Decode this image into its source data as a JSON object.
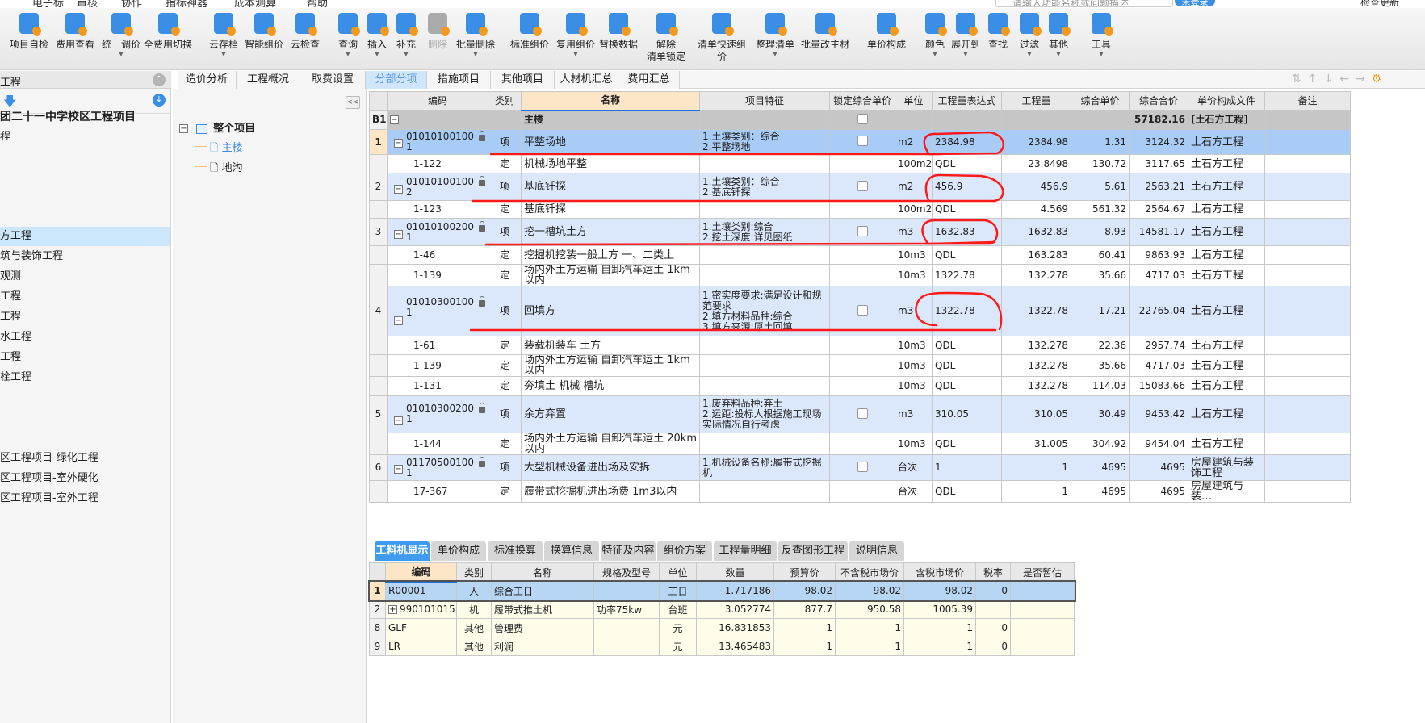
{
  "menu": [
    "电子标",
    "审核",
    "协作",
    "指标神器",
    "成本测算",
    "帮助"
  ],
  "search_placeholder": "请输入功能名称或问题描述",
  "login_label": "未登录",
  "update_label": "检查更新",
  "toolbar": [
    {
      "label": "项目自检",
      "icon": "check-report-icon",
      "color": "#3a8ee6",
      "dropdown": false
    },
    {
      "label": "费用查看",
      "icon": "cost-view-icon",
      "color": "#3a8ee6",
      "dropdown": false
    },
    {
      "label": "统一调价",
      "icon": "adjust-price-icon",
      "color": "#3a8ee6",
      "dropdown": true
    },
    {
      "label": "全费用切换",
      "icon": "switch-icon",
      "color": "#3a8ee6",
      "dropdown": false
    },
    {
      "label": "云存档",
      "icon": "cloud-upload-icon",
      "color": "#3a8ee6",
      "dropdown": true
    },
    {
      "label": "智能组价",
      "icon": "smart-price-icon",
      "color": "#3a8ee6",
      "dropdown": false
    },
    {
      "label": "云检查",
      "icon": "cloud-check-icon",
      "color": "#3a8ee6",
      "dropdown": false
    },
    {
      "label": "查询",
      "icon": "query-icon",
      "color": "#3a8ee6",
      "dropdown": true
    },
    {
      "label": "插入",
      "icon": "insert-icon",
      "color": "#3a8ee6",
      "dropdown": true
    },
    {
      "label": "补充",
      "icon": "supplement-icon",
      "color": "#3a8ee6",
      "dropdown": true
    },
    {
      "label": "删除",
      "icon": "trash-icon",
      "color": "#aaaaaa",
      "dropdown": false,
      "disabled": true
    },
    {
      "label": "批量删除",
      "icon": "batch-delete-icon",
      "color": "#3a8ee6",
      "dropdown": true
    },
    {
      "label": "标准组价",
      "icon": "standard-price-icon",
      "color": "#3a8ee6",
      "dropdown": false
    },
    {
      "label": "复用组价",
      "icon": "reuse-price-icon",
      "color": "#3a8ee6",
      "dropdown": true
    },
    {
      "label": "替换数据",
      "icon": "replace-data-icon",
      "color": "#3a8ee6",
      "dropdown": false
    },
    {
      "label": "解除\n清单锁定",
      "icon": "unlock-icon",
      "color": "#3a8ee6",
      "dropdown": false
    },
    {
      "label": "清单快速组价",
      "icon": "quick-price-icon",
      "color": "#3a8ee6",
      "dropdown": false
    },
    {
      "label": "整理清单",
      "icon": "organize-list-icon",
      "color": "#3a8ee6",
      "dropdown": true
    },
    {
      "label": "批量改主材",
      "icon": "batch-material-icon",
      "color": "#3a8ee6",
      "dropdown": false
    },
    {
      "label": "单价构成",
      "icon": "unit-price-icon",
      "color": "#3a8ee6",
      "dropdown": false
    },
    {
      "label": "颜色",
      "icon": "paint-bucket-icon",
      "color": "#3a8ee6",
      "dropdown": true
    },
    {
      "label": "展开到",
      "icon": "expand-icon",
      "color": "#3a8ee6",
      "dropdown": true
    },
    {
      "label": "查找",
      "icon": "binoculars-icon",
      "color": "#3a8ee6",
      "dropdown": false
    },
    {
      "label": "过滤",
      "icon": "filter-icon",
      "color": "#3a8ee6",
      "dropdown": true
    },
    {
      "label": "其他",
      "icon": "grid-more-icon",
      "color": "#3a8ee6",
      "dropdown": true
    },
    {
      "label": "工具",
      "icon": "tools-icon",
      "color": "#3a8ee6",
      "dropdown": true
    }
  ],
  "left_panel": {
    "header": "工程",
    "items": [
      "团二十一中学校区工程项目",
      "程",
      "方工程",
      "筑与装饰工程",
      "观测",
      "工程",
      "工程",
      "水工程",
      "工程",
      "栓工程",
      "区工程项目-绿化工程",
      "区工程项目-室外硬化",
      "区工程项目-室外工程"
    ],
    "selected_index": 2
  },
  "tree": {
    "root": "整个项目",
    "children": [
      "主楼",
      "地沟"
    ],
    "selected": "主楼"
  },
  "tabs": [
    "造价分析",
    "工程概况",
    "取费设置",
    "分部分项",
    "措施项目",
    "其他项目",
    "人材机汇总",
    "费用汇总"
  ],
  "active_tab": "分部分项",
  "main_table": {
    "columns": [
      "",
      "编码",
      "类别",
      "名称",
      "项目特征",
      "锁定综合单价",
      "单位",
      "工程量表达式",
      "工程量",
      "综合单价",
      "综合合价",
      "单价构成文件",
      "备注"
    ],
    "section": {
      "no": "B1",
      "name": "主楼",
      "total": "57182.16",
      "file": "[土石方工程]"
    },
    "rows": [
      {
        "kind": "item",
        "no": "1",
        "code": "01010100100\n1",
        "type": "项",
        "name": "平整场地",
        "feature": "1.土壤类别：综合\n2.平整场地",
        "unit": "m2",
        "expr": "2384.98",
        "qty": "2384.98",
        "price": "1.31",
        "total": "3124.32",
        "file": "土石方工程",
        "locked": true
      },
      {
        "kind": "sub",
        "no": "",
        "code": "1-122",
        "type": "定",
        "name": "机械场地平整",
        "feature": "",
        "unit": "100m2",
        "expr": "QDL",
        "qty": "23.8498",
        "price": "130.72",
        "total": "3117.65",
        "file": "土石方工程"
      },
      {
        "kind": "item",
        "no": "2",
        "code": "01010100100\n2",
        "type": "项",
        "name": "基底钎探",
        "feature": "1.土壤类别：综合\n2.基底钎探",
        "unit": "m2",
        "expr": "456.9",
        "qty": "456.9",
        "price": "5.61",
        "total": "2563.21",
        "file": "土石方工程",
        "locked": true
      },
      {
        "kind": "sub",
        "no": "",
        "code": "1-123",
        "type": "定",
        "name": "基底钎探",
        "feature": "",
        "unit": "100m2",
        "expr": "QDL",
        "qty": "4.569",
        "price": "561.32",
        "total": "2564.67",
        "file": "土石方工程"
      },
      {
        "kind": "item",
        "no": "3",
        "code": "01010100200\n1",
        "type": "项",
        "name": "挖一槽坑土方",
        "feature": "1.土壤类别:综合\n2.挖土深度:详见图纸",
        "unit": "m3",
        "expr": "1632.83",
        "qty": "1632.83",
        "price": "8.93",
        "total": "14581.17",
        "file": "土石方工程",
        "locked": true
      },
      {
        "kind": "sub",
        "no": "",
        "code": "1-46",
        "type": "定",
        "name": "挖掘机挖装一般土方 一、二类土",
        "feature": "",
        "unit": "10m3",
        "expr": "QDL",
        "qty": "163.283",
        "price": "60.41",
        "total": "9863.93",
        "file": "土石方工程"
      },
      {
        "kind": "sub",
        "no": "",
        "code": "1-139",
        "type": "定",
        "name": "场内外土方运输 自卸汽车运土 1km以内",
        "feature": "",
        "unit": "10m3",
        "expr": "1322.78",
        "qty": "132.278",
        "price": "35.66",
        "total": "4717.03",
        "file": "土石方工程"
      },
      {
        "kind": "item",
        "no": "4",
        "code": "01010300100\n1",
        "type": "项",
        "name": "回填方",
        "feature": "1.密实度要求:满足设计和规范要求\n2.填方材料品种:综合\n3.填方来源:原土回填",
        "unit": "m3",
        "expr": "1322.78",
        "qty": "1322.78",
        "price": "17.21",
        "total": "22765.04",
        "file": "土石方工程",
        "locked": true
      },
      {
        "kind": "sub",
        "no": "",
        "code": "1-61",
        "type": "定",
        "name": "装载机装车 土方",
        "feature": "",
        "unit": "10m3",
        "expr": "QDL",
        "qty": "132.278",
        "price": "22.36",
        "total": "2957.74",
        "file": "土石方工程"
      },
      {
        "kind": "sub",
        "no": "",
        "code": "1-139",
        "type": "定",
        "name": "场内外土方运输 自卸汽车运土 1km以内",
        "feature": "",
        "unit": "10m3",
        "expr": "QDL",
        "qty": "132.278",
        "price": "35.66",
        "total": "4717.03",
        "file": "土石方工程"
      },
      {
        "kind": "sub",
        "no": "",
        "code": "1-131",
        "type": "定",
        "name": "夯填土 机械 槽坑",
        "feature": "",
        "unit": "10m3",
        "expr": "QDL",
        "qty": "132.278",
        "price": "114.03",
        "total": "15083.66",
        "file": "土石方工程"
      },
      {
        "kind": "item",
        "no": "5",
        "code": "01010300200\n1",
        "type": "项",
        "name": "余方弃置",
        "feature": "1.废弃料品种:弃土\n2.运距:投标人根据施工现场实际情况自行考虑",
        "unit": "m3",
        "expr": "310.05",
        "qty": "310.05",
        "price": "30.49",
        "total": "9453.42",
        "file": "土石方工程",
        "locked": true
      },
      {
        "kind": "sub",
        "no": "",
        "code": "1-144",
        "type": "定",
        "name": "场内外土方运输 自卸汽车运土 20km以内",
        "feature": "",
        "unit": "10m3",
        "expr": "QDL",
        "qty": "31.005",
        "price": "304.92",
        "total": "9454.04",
        "file": "土石方工程"
      },
      {
        "kind": "item",
        "no": "6",
        "code": "01170500100\n1",
        "type": "项",
        "name": "大型机械设备进出场及安拆",
        "feature": "1.机械设备名称:履带式挖掘机",
        "unit": "台次",
        "expr": "1",
        "qty": "1",
        "price": "4695",
        "total": "4695",
        "file": "房屋建筑与装饰工程",
        "locked": true
      },
      {
        "kind": "sub",
        "no": "",
        "code": "17-367",
        "type": "定",
        "name": "履带式挖掘机进出场费 1m3以内",
        "feature": "",
        "unit": "台次",
        "expr": "QDL",
        "qty": "1",
        "price": "4695",
        "total": "4695",
        "file": "房屋建筑与装…"
      }
    ],
    "selected_row": 0
  },
  "bottom_tabs": [
    "工料机显示",
    "单价构成",
    "标准换算",
    "换算信息",
    "特征及内容",
    "组价方案",
    "工程量明细",
    "反查图形工程量",
    "说明信息"
  ],
  "bottom_active_tab": "工料机显示",
  "sub_table": {
    "columns": [
      "",
      "编码",
      "类别",
      "名称",
      "规格及型号",
      "单位",
      "数量",
      "预算价",
      "不含税市场价",
      "含税市场价",
      "税率",
      "是否暂估"
    ],
    "rows": [
      {
        "no": "1",
        "code": "R00001",
        "type": "人",
        "name": "综合工日",
        "spec": "",
        "unit": "工日",
        "qty": "1.717186",
        "budget": "98.02",
        "market_ex": "98.02",
        "market_in": "98.02",
        "tax": "0",
        "est": "",
        "expand": false
      },
      {
        "no": "2",
        "code": "990101015",
        "type": "机",
        "name": "履带式推土机",
        "spec": "功率75kw",
        "unit": "台班",
        "qty": "3.052774",
        "budget": "877.7",
        "market_ex": "950.58",
        "market_in": "1005.39",
        "tax": "",
        "est": "",
        "expand": true
      },
      {
        "no": "8",
        "code": "GLF",
        "type": "其他",
        "name": "管理费",
        "spec": "",
        "unit": "元",
        "qty": "16.831853",
        "budget": "1",
        "market_ex": "1",
        "market_in": "1",
        "tax": "0",
        "est": "",
        "expand": false
      },
      {
        "no": "9",
        "code": "LR",
        "type": "其他",
        "name": "利润",
        "spec": "",
        "unit": "元",
        "qty": "13.465483",
        "budget": "1",
        "market_ex": "1",
        "market_in": "1",
        "tax": "0",
        "est": "",
        "expand": false
      }
    ],
    "selected_row": 0
  },
  "annotation_color": "#ff1a1a"
}
